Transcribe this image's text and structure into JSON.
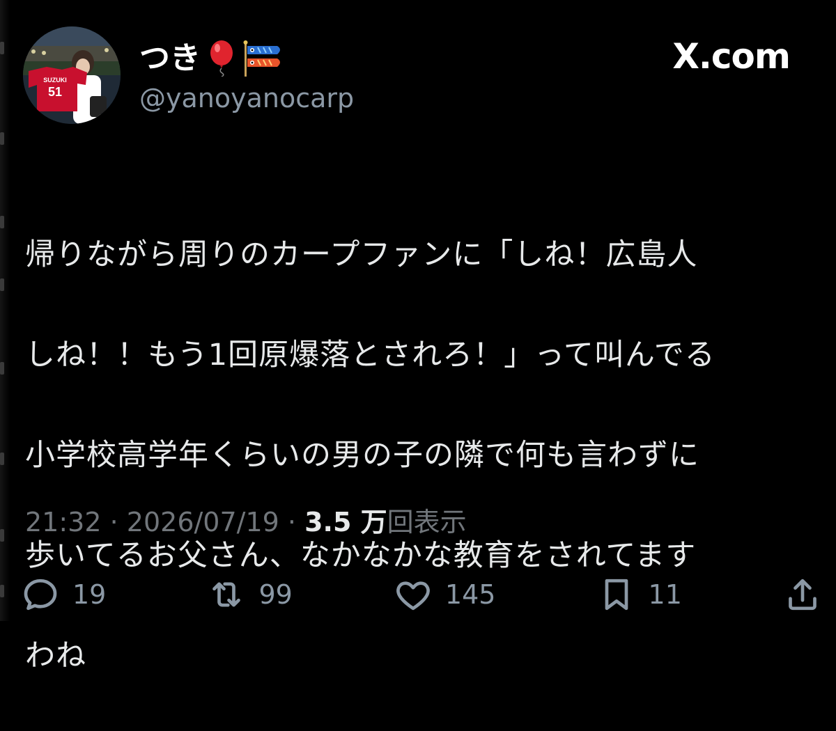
{
  "header": {
    "display_name": "つき",
    "handle": "@yanoyanocarp",
    "site": "X.com",
    "avatar_jersey_name": "SUZUKI",
    "avatar_jersey_number": "51"
  },
  "tweet": {
    "lines": [
      "帰りながら周りのカープファンに「しね！広島人",
      "しね！！もう1回原爆落とされろ！」って叫んでる",
      "小学校高学年くらいの男の子の隣で何も言わずに",
      "歩いてるお父さん、なかなかな教育をされてます",
      "わね"
    ]
  },
  "meta": {
    "time": "21:32",
    "date": "2026/07/19",
    "separator": "·",
    "views_count": "3.5 万",
    "views_label": "回表示"
  },
  "actions": {
    "reply": {
      "icon": "reply-icon",
      "count": "19"
    },
    "retweet": {
      "icon": "retweet-icon",
      "count": "99"
    },
    "like": {
      "icon": "heart-icon",
      "count": "145"
    },
    "bookmark": {
      "icon": "bookmark-icon",
      "count": "11"
    },
    "share": {
      "icon": "share-icon"
    }
  },
  "colors": {
    "background": "#000000",
    "text": "#e7e9ea",
    "secondary": "#71767b",
    "icon": "#8b98a5"
  }
}
